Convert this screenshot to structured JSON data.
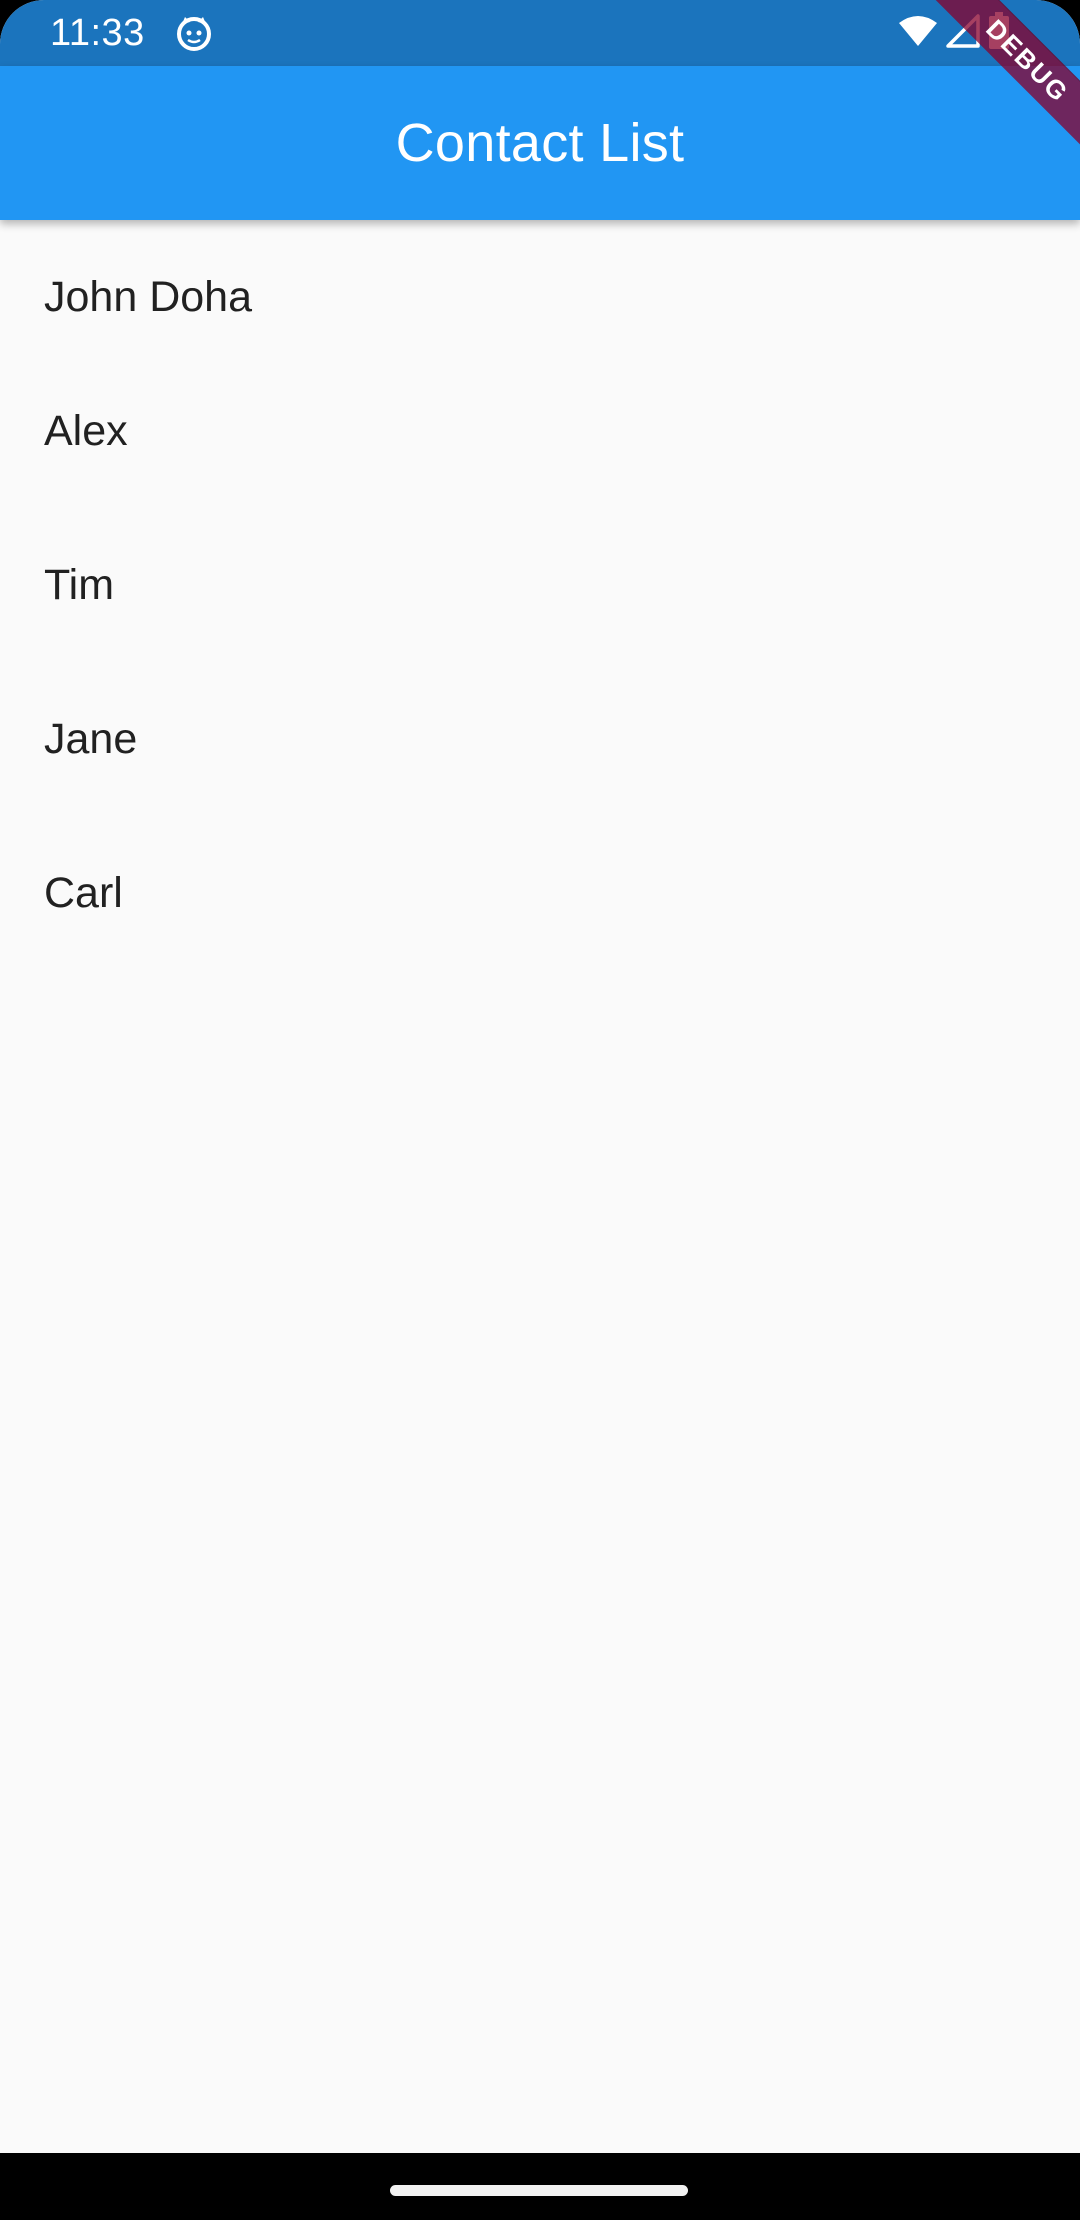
{
  "status_bar": {
    "time": "11:33",
    "app_icon": "cat-face-icon",
    "wifi_icon": "wifi-icon",
    "signal_icon": "cell-signal-icon",
    "battery_icon": "battery-icon"
  },
  "app_bar": {
    "title": "Contact List",
    "color": "#2196f3"
  },
  "debug_banner": {
    "label": "DEBUG"
  },
  "contacts": [
    {
      "name": "John Doha"
    },
    {
      "name": "Alex"
    },
    {
      "name": "Tim"
    },
    {
      "name": "Jane"
    },
    {
      "name": "Carl"
    }
  ],
  "colors": {
    "status_bar": "#1b74bd",
    "app_bar": "#2196f3",
    "background": "#fafafa",
    "text": "#212121"
  }
}
